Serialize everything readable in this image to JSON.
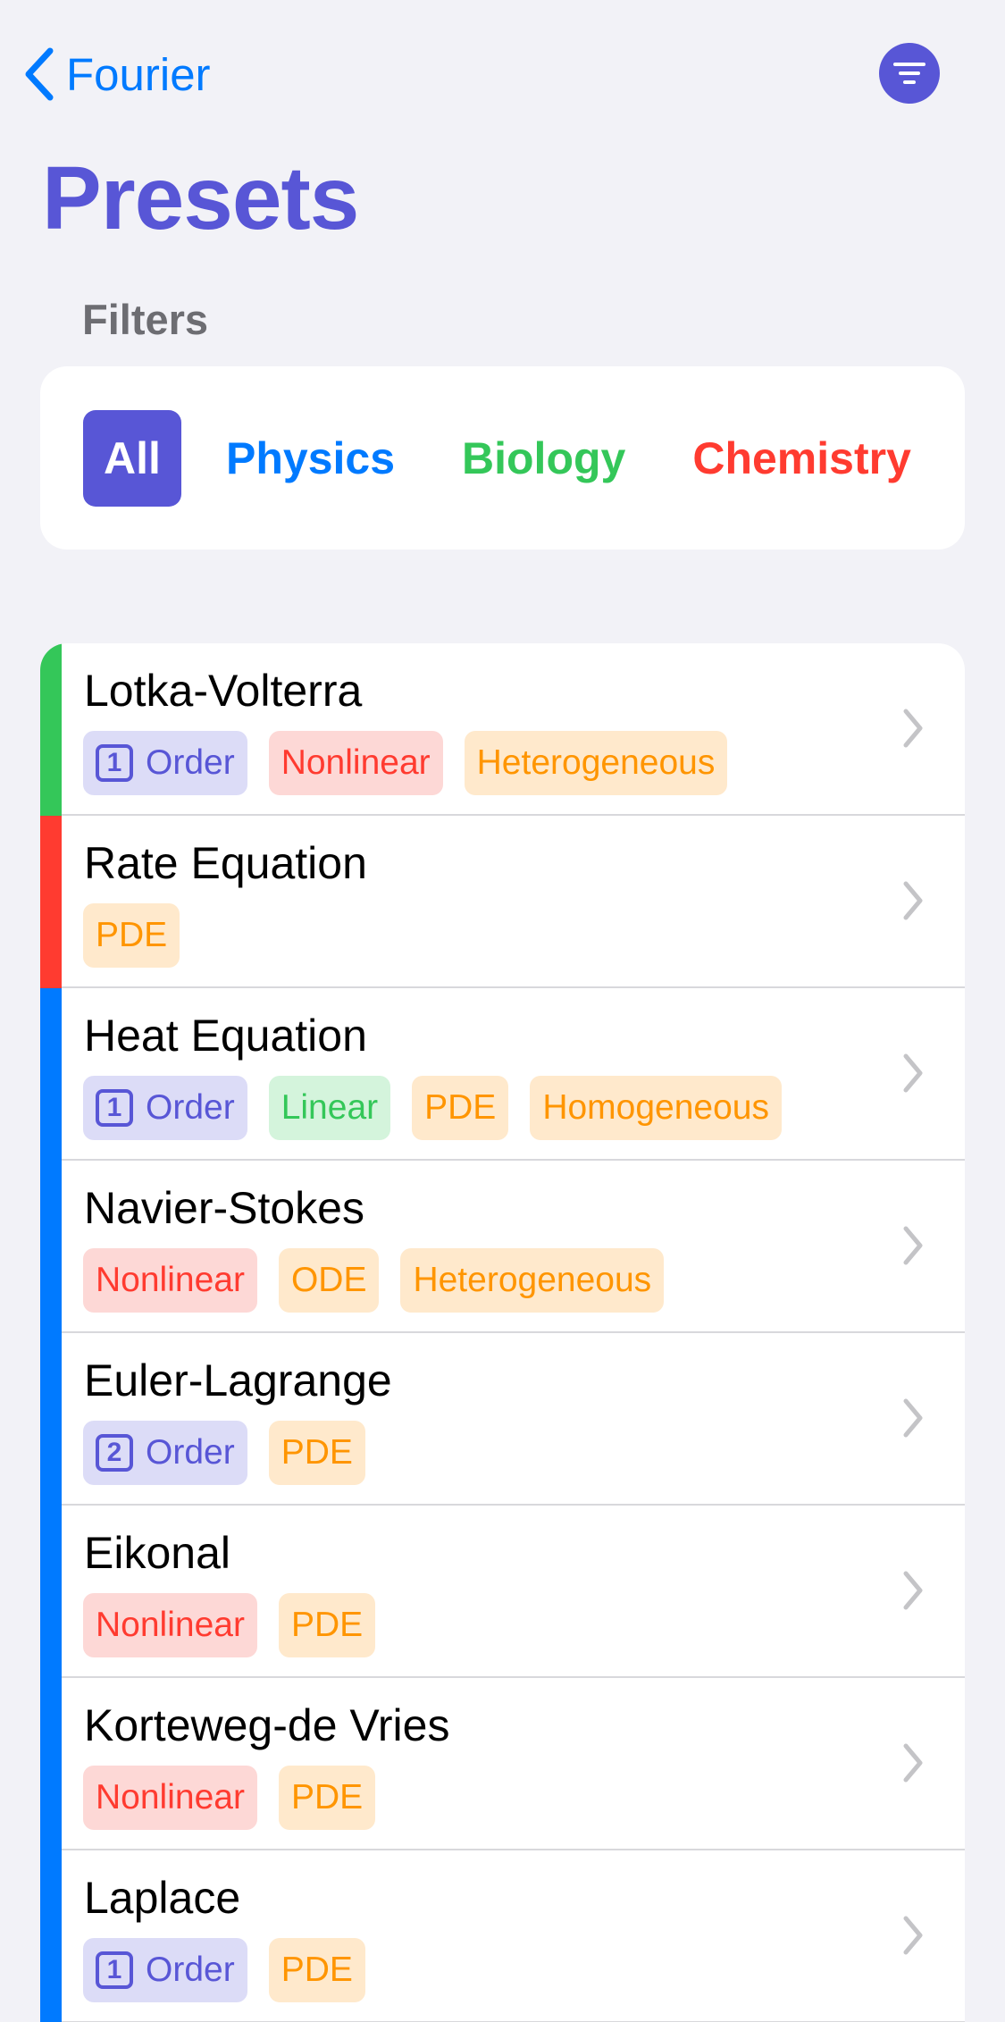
{
  "nav": {
    "back_label": "Fourier",
    "back_icon": "chevron-left-icon",
    "filter_icon": "line-3-horizontal-decrease-icon"
  },
  "title": "Presets",
  "filters": {
    "header": "Filters",
    "options": [
      "All",
      "Physics",
      "Biology",
      "Chemistry"
    ],
    "selected": "All"
  },
  "colors": {
    "accent": "#5856d6",
    "physics": "#007aff",
    "biology": "#34c759",
    "chemistry": "#ff3b30"
  },
  "presets": [
    {
      "name": "Lotka-Volterra",
      "category": "Biology",
      "order": "1",
      "order_label": "Order",
      "tags": [
        "Nonlinear",
        "Heterogeneous"
      ]
    },
    {
      "name": "Rate Equation",
      "category": "Chemistry",
      "tags": [
        "PDE"
      ]
    },
    {
      "name": "Heat Equation",
      "category": "Physics",
      "order": "1",
      "order_label": "Order",
      "tags": [
        "Linear",
        "PDE",
        "Homogeneous"
      ]
    },
    {
      "name": "Navier-Stokes",
      "category": "Physics",
      "tags": [
        "Nonlinear",
        "ODE",
        "Heterogeneous"
      ]
    },
    {
      "name": "Euler-Lagrange",
      "category": "Physics",
      "order": "2",
      "order_label": "Order",
      "tags": [
        "PDE"
      ]
    },
    {
      "name": "Eikonal",
      "category": "Physics",
      "tags": [
        "Nonlinear",
        "PDE"
      ]
    },
    {
      "name": "Korteweg-de Vries",
      "category": "Physics",
      "tags": [
        "Nonlinear",
        "PDE"
      ]
    },
    {
      "name": "Laplace",
      "category": "Physics",
      "order": "1",
      "order_label": "Order",
      "tags": [
        "PDE"
      ]
    }
  ]
}
